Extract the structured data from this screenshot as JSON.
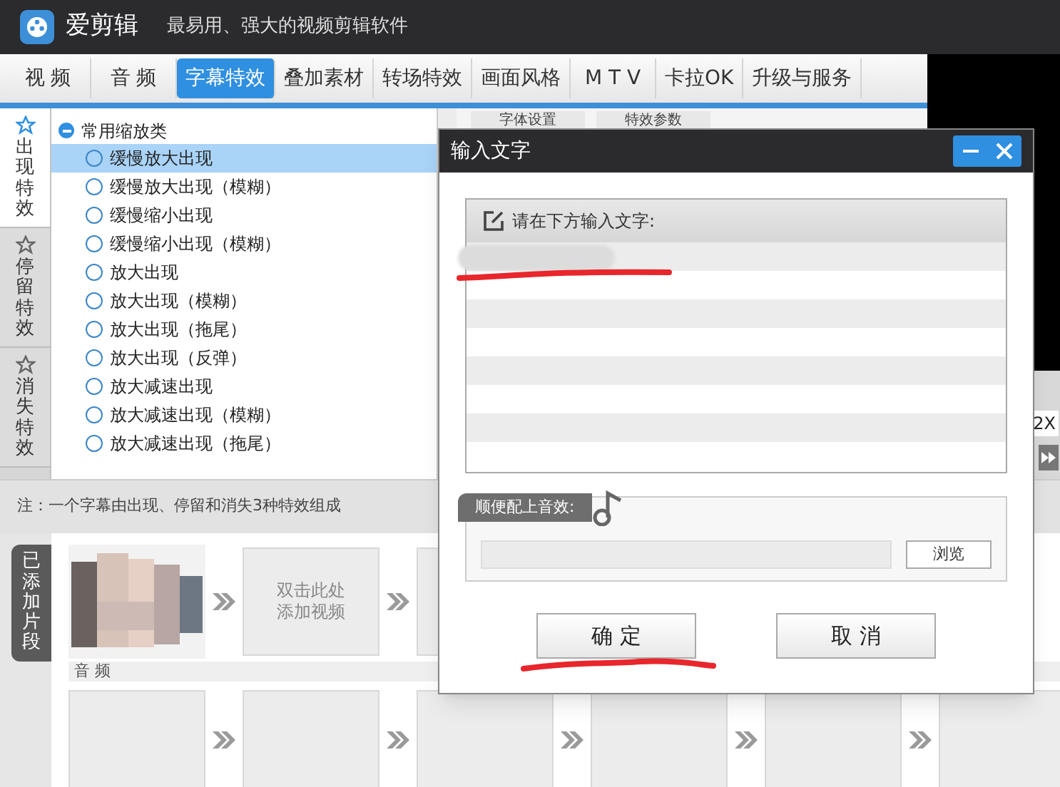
{
  "app": {
    "name": "爱剪辑",
    "tagline": "最易用、强大的视频剪辑软件"
  },
  "tabs": [
    {
      "label": "视 频",
      "selected": false
    },
    {
      "label": "音 频",
      "selected": false
    },
    {
      "label": "字幕特效",
      "selected": true
    },
    {
      "label": "叠加素材",
      "selected": false
    },
    {
      "label": "转场特效",
      "selected": false
    },
    {
      "label": "画面风格",
      "selected": false
    },
    {
      "label": "M T V",
      "selected": false
    },
    {
      "label": "卡拉OK",
      "selected": false
    },
    {
      "label": "升级与服务",
      "selected": false
    }
  ],
  "effect_categories": [
    {
      "label": "出现特效",
      "selected": true
    },
    {
      "label": "停留特效",
      "selected": false
    },
    {
      "label": "消失特效",
      "selected": false
    }
  ],
  "effect_group": {
    "label": "常用缩放类",
    "expanded": true
  },
  "effects": [
    {
      "label": "缓慢放大出现",
      "selected": true
    },
    {
      "label": "缓慢放大出现（模糊）",
      "selected": false
    },
    {
      "label": "缓慢缩小出现",
      "selected": false
    },
    {
      "label": "缓慢缩小出现（模糊）",
      "selected": false
    },
    {
      "label": "放大出现",
      "selected": false
    },
    {
      "label": "放大出现（模糊）",
      "selected": false
    },
    {
      "label": "放大出现（拖尾）",
      "selected": false
    },
    {
      "label": "放大出现（反弹）",
      "selected": false
    },
    {
      "label": "放大减速出现",
      "selected": false
    },
    {
      "label": "放大减速出现（模糊）",
      "selected": false
    },
    {
      "label": "放大减速出现（拖尾）",
      "selected": false
    }
  ],
  "settings_tabs": [
    {
      "label": "字体设置"
    },
    {
      "label": "特效参数"
    }
  ],
  "speed": "2X",
  "note": "注：一个字幕由出现、停留和消失3种特效组成",
  "clips_panel": {
    "label": "已添加片段",
    "clips": [
      {
        "kind": "picture"
      },
      {
        "kind": "add",
        "label": "双击此处添加视频"
      },
      {
        "kind": "empty"
      }
    ],
    "audio_label": "音 频",
    "audio_slots": [
      {
        "kind": "empty"
      },
      {
        "kind": "empty"
      },
      {
        "kind": "empty"
      },
      {
        "kind": "empty"
      },
      {
        "kind": "empty"
      },
      {
        "kind": "empty"
      }
    ]
  },
  "dialog": {
    "title": "输入文字",
    "prompt": "请在下方输入文字:",
    "sound_label": "顺便配上音效:",
    "browse": "浏览",
    "ok": "确 定",
    "cancel": "取 消"
  }
}
